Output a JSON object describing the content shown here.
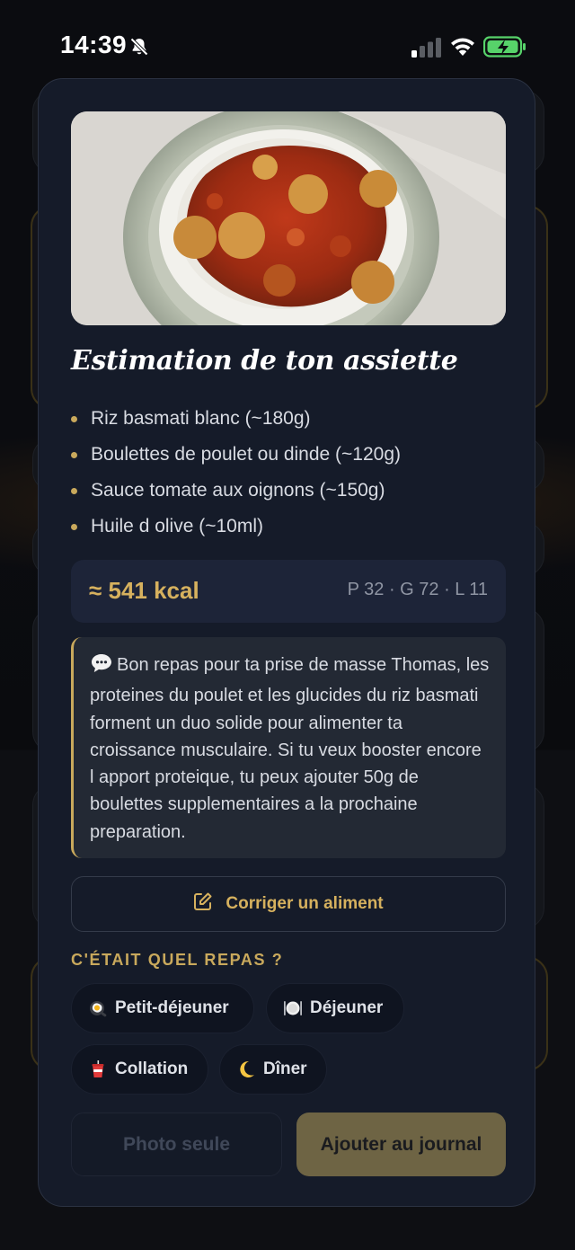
{
  "status_bar": {
    "time": "14:39"
  },
  "modal": {
    "photo_alt": "Assiette de riz basmati avec boulettes et sauce tomate",
    "title": "Estimation de ton assiette",
    "items": [
      {
        "label": "Riz basmati blanc (~180g)"
      },
      {
        "label": "Boulettes de poulet ou dinde (~120g)"
      },
      {
        "label": "Sauce tomate aux oignons (~150g)"
      },
      {
        "label": "Huile d olive (~10ml)"
      }
    ],
    "nutrition": {
      "kcal": "≈ 541 kcal",
      "macros": "P 32 · G 72 · L 11"
    },
    "advice": "Bon repas pour ta prise de masse Thomas, les proteines du poulet et les glucides du riz basmati forment un duo solide pour alimenter ta croissance musculaire. Si tu veux booster encore l apport proteique, tu peux ajouter 50g de boulettes supplementaires a la prochaine preparation.",
    "fix_button": "Corriger un aliment",
    "meal_heading": "C'ÉTAIT QUEL REPAS ?",
    "meals": [
      {
        "label": "Petit-déjeuner",
        "icon": "fried-egg-icon"
      },
      {
        "label": "Déjeuner",
        "icon": "plate-cutlery-icon"
      },
      {
        "label": "Collation",
        "icon": "cup-icon"
      },
      {
        "label": "Dîner",
        "icon": "crescent-moon-icon"
      }
    ],
    "btn_photo_only": "Photo seule",
    "btn_add": "Ajouter au journal"
  },
  "colors": {
    "accent_gold": "#c9a95c",
    "modal_bg": "#151b29",
    "primary_button": "#6e6444"
  }
}
